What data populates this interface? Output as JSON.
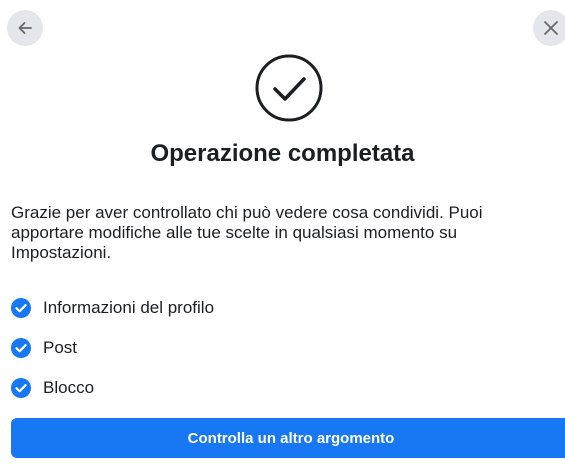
{
  "header": {
    "back_icon": "arrow-left-icon",
    "close_icon": "close-icon"
  },
  "status_icon": "check-circle-icon",
  "title": "Operazione completata",
  "description": "Grazie per aver controllato chi può vedere cosa condividi. Puoi apportare modifiche alle tue scelte in qualsiasi momento su Impostazioni.",
  "checklist": [
    {
      "label": "Informazioni del profilo",
      "icon": "check-badge-icon"
    },
    {
      "label": "Post",
      "icon": "check-badge-icon"
    },
    {
      "label": "Blocco",
      "icon": "check-badge-icon"
    }
  ],
  "primary_button": {
    "label": "Controlla un altro argomento"
  },
  "colors": {
    "accent": "#1877f2",
    "icon_button_bg": "#e4e6eb",
    "text": "#1c1e21"
  }
}
